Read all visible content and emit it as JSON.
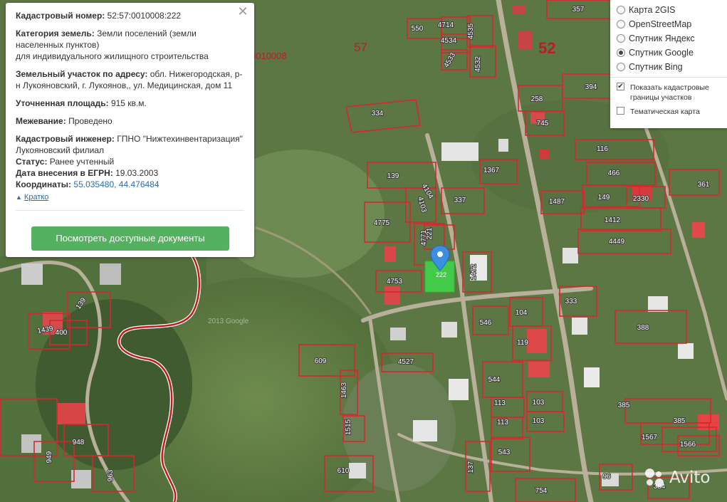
{
  "info": {
    "cadastral_number_label": "Кадастровый номер:",
    "cadastral_number": "52:57:0010008:222",
    "category_label": "Категория земель:",
    "category_value": "Земли поселений (земли населенных пунктов)",
    "category_purpose": "для индивидуального жилищного строительства",
    "address_label": "Земельный участок по адресу:",
    "address_value": "обл. Нижегородская, р-н Лукояновский, г. Лукоянов,, ул. Медицинская, дом 11",
    "area_label": "Уточненная площадь:",
    "area_value": "915 кв.м.",
    "survey_label": "Межевание:",
    "survey_value": "Проведено",
    "engineer_label": "Кадастровый инженер:",
    "engineer_value": "ГПНО \"Нижтехинвентаризация\" Лукояновский филиал",
    "status_label": "Статус:",
    "status_value": "Ранее учтенный",
    "date_label": "Дата внесения в ЕГРН:",
    "date_value": "19.03.2003",
    "coords_label": "Координаты:",
    "coords_value": "55.035480, 44.476484",
    "collapse_link": "Кратко",
    "docs_button": "Посмотреть доступные документы",
    "close_symbol": "✕"
  },
  "layers": {
    "options": [
      {
        "label": "Карта 2GIS",
        "selected": false
      },
      {
        "label": "OpenStreetMap",
        "selected": false
      },
      {
        "label": "Спутник Яндекс",
        "selected": false
      },
      {
        "label": "Спутник Google",
        "selected": true
      },
      {
        "label": "Спутник Bing",
        "selected": false
      }
    ],
    "show_borders": "Показать кадастровые границы участков",
    "show_borders_checked": true,
    "thematic": "Тематическая карта",
    "thematic_checked": false
  },
  "map": {
    "block_label": "0010008",
    "quarter_label": "57",
    "district_label": "52",
    "watermark": "2013 Google",
    "parcel_numbers": [
      "357",
      "550",
      "4714",
      "4535",
      "4534",
      "4533",
      "4532",
      "334",
      "258",
      "745",
      "394",
      "116",
      "466",
      "361",
      "149",
      "2330",
      "1487",
      "1412",
      "4449",
      "139",
      "1367",
      "337",
      "4104",
      "4103",
      "4775",
      "4771",
      "221",
      "1472",
      "4753",
      "104",
      "333",
      "546",
      "119",
      "388",
      "609",
      "4527",
      "544",
      "103",
      "113",
      "103",
      "113",
      "1463",
      "1515",
      "543",
      "385",
      "385",
      "1567",
      "1566",
      "610",
      "137",
      "96",
      "754",
      "384",
      "139",
      "1439",
      "400",
      "948",
      "949",
      "963"
    ],
    "selected_parcel": "222"
  },
  "brand": {
    "avito_text": "Avito"
  },
  "colors": {
    "parcel_border": "#d8262e",
    "selected_fill": "#3cd94a",
    "button_green": "#53b15f",
    "link_blue": "#2a6cb3",
    "marker_blue": "#3b8ee0",
    "boundary_red": "#c21a1a"
  }
}
